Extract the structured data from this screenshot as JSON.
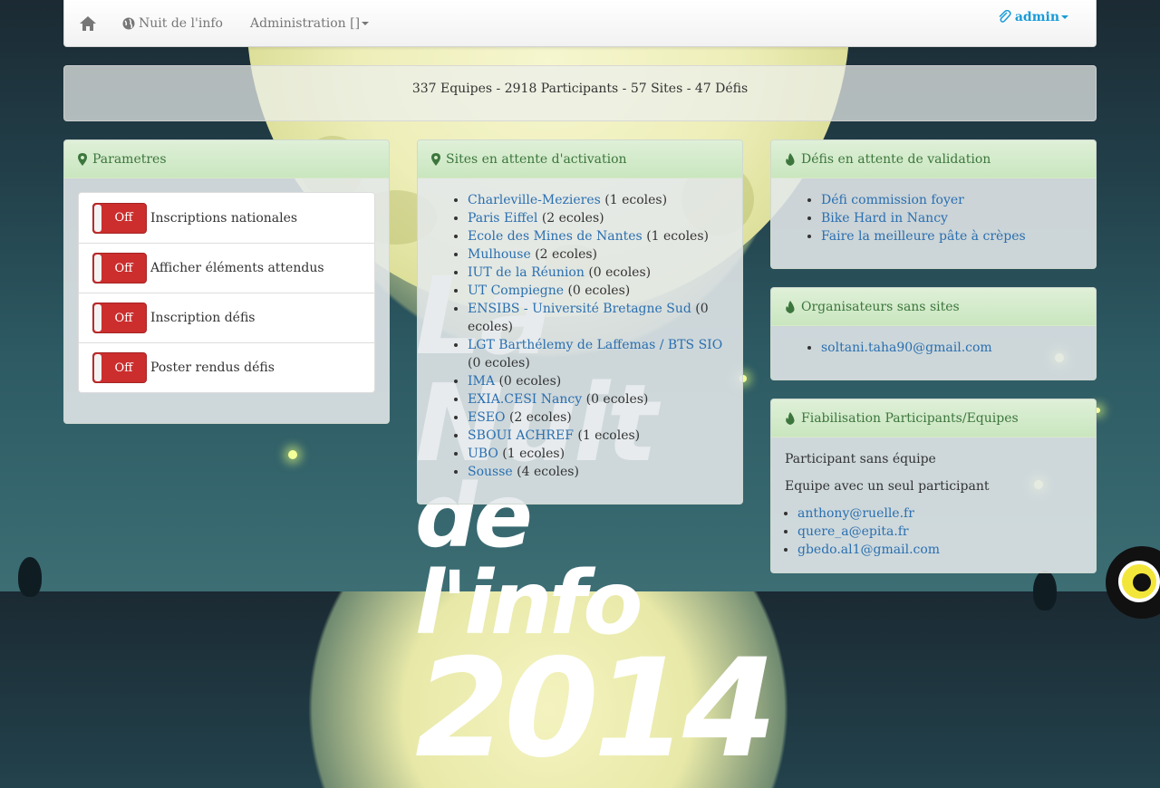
{
  "navbar": {
    "home_icon": "home-icon",
    "brand": "Nuit de l'info",
    "admin_menu": "Administration []",
    "user": "admin"
  },
  "stats": "337 Equipes - 2918 Participants - 57 Sites - 47 Défis",
  "background": {
    "title_line1": "La Nuit",
    "title_line2": "de l'info",
    "title_line3": "2014"
  },
  "parametres": {
    "title": "Parametres",
    "items": [
      {
        "switch": "Off",
        "label": "Inscriptions nationales"
      },
      {
        "switch": "Off",
        "label": "Afficher éléments attendus"
      },
      {
        "switch": "Off",
        "label": "Inscription défis"
      },
      {
        "switch": "Off",
        "label": "Poster rendus défis"
      }
    ]
  },
  "sites": {
    "title": "Sites en attente d'activation",
    "items": [
      {
        "name": "Charleville-Mezieres",
        "count": "(1 ecoles)"
      },
      {
        "name": "Paris Eiffel",
        "count": "(2 ecoles)"
      },
      {
        "name": "Ecole des Mines de Nantes",
        "count": "(1 ecoles)"
      },
      {
        "name": "Mulhouse",
        "count": "(2 ecoles)"
      },
      {
        "name": "IUT de la Réunion",
        "count": "(0 ecoles)"
      },
      {
        "name": "UT Compiegne",
        "count": "(0 ecoles)"
      },
      {
        "name": "ENSIBS - Université Bretagne Sud",
        "count": "(0 ecoles)"
      },
      {
        "name": "LGT Barthélemy de Laffemas / BTS SIO",
        "count": "(0 ecoles)"
      },
      {
        "name": "IMA",
        "count": "(0 ecoles)"
      },
      {
        "name": "EXIA.CESI Nancy",
        "count": "(0 ecoles)"
      },
      {
        "name": "ESEO",
        "count": "(2 ecoles)"
      },
      {
        "name": "SBOUI ACHREF",
        "count": "(1 ecoles)"
      },
      {
        "name": "UBO",
        "count": "(1 ecoles)"
      },
      {
        "name": "Sousse",
        "count": "(4 ecoles)"
      }
    ]
  },
  "defis": {
    "title": "Défis en attente de validation",
    "items": [
      "Défi commission foyer",
      "Bike Hard in Nancy",
      "Faire la meilleure pâte à crèpes"
    ]
  },
  "organisateurs": {
    "title": "Organisateurs sans sites",
    "items": [
      "soltani.taha90@gmail.com"
    ]
  },
  "fiabilisation": {
    "title": "Fiabilisation Participants/Equipes",
    "sans_equipe": "Participant sans équipe",
    "seul_participant": "Equipe avec un seul participant",
    "items": [
      "anthony@ruelle.fr",
      "quere_a@epita.fr",
      "gbedo.al1@gmail.com"
    ]
  }
}
